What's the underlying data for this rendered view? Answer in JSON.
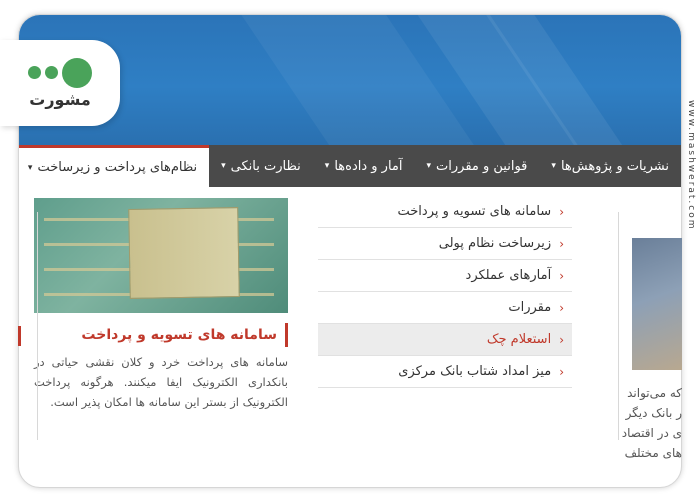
{
  "logo": {
    "word": "مشورت"
  },
  "watermark": "www.mashwerat.com",
  "navbar": {
    "items": [
      {
        "label": "نشریات و پژوهش‌ها",
        "caret": "▾"
      },
      {
        "label": "قوانین و مقررات",
        "caret": "▾"
      },
      {
        "label": "آمار و داده‌ها",
        "caret": "▾"
      },
      {
        "label": "نظارت بانکی",
        "caret": "▾"
      },
      {
        "label": "نظام‌های پرداخت و زیرساخت",
        "caret": "▾"
      }
    ]
  },
  "card": {
    "title": "سامانه های تسویه و پرداخت",
    "description": "سامانه های پرداخت خرد و کلان نقشی حیاتی در بانکداری الکترونیک ایفا میکنند. هرگونه پرداخت الکترونیک از بستر این سامانه ها امکان پذیر است."
  },
  "menu": {
    "items": [
      {
        "label": "سامانه های تسویه و پرداخت"
      },
      {
        "label": "زیرساخت نظام پولی"
      },
      {
        "label": "آمارهای عملکرد"
      },
      {
        "label": "مقررات"
      },
      {
        "label": "استعلام چک"
      },
      {
        "label": "میز امداد شتاب بانک مرکزی"
      }
    ],
    "chevron": "‹",
    "active_index": 4
  },
  "right_column": {
    "lines": [
      "که می‌تواند",
      "ر بانک دیگر",
      "ی در اقتصاد",
      "های مختلف"
    ]
  },
  "colors": {
    "accent": "#c0392b",
    "navbar": "#4a4a4a",
    "banner": "#2f7fc4",
    "logo_green": "#4aa35a"
  }
}
